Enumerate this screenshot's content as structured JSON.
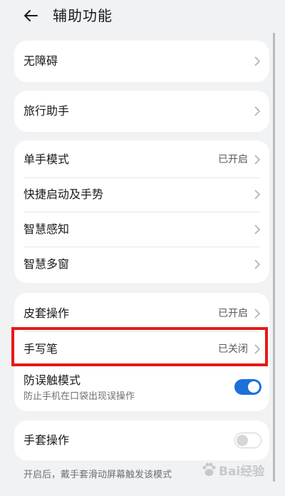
{
  "header": {
    "title": "辅助功能"
  },
  "card1": {
    "item": {
      "label": "无障碍"
    }
  },
  "card2": {
    "item": {
      "label": "旅行助手"
    }
  },
  "card3": {
    "items": [
      {
        "label": "单手模式",
        "status": "已开启"
      },
      {
        "label": "快捷启动及手势",
        "status": ""
      },
      {
        "label": "智慧感知",
        "status": ""
      },
      {
        "label": "智慧多窗",
        "status": ""
      }
    ]
  },
  "card4": {
    "items": [
      {
        "label": "皮套操作",
        "status": "已开启"
      },
      {
        "label": "手写笔",
        "status": "已关闭"
      }
    ],
    "toggle_item": {
      "label": "防误触模式",
      "description": "防止手机在口袋出现误操作",
      "on": true
    }
  },
  "card5": {
    "toggle_item": {
      "label": "手套操作",
      "on": false
    }
  },
  "footnote": "开启后，戴手套滑动屏幕触发该模式",
  "watermark": {
    "text": "Bai经验"
  },
  "colors": {
    "accent": "#1e6fd9",
    "highlight": "#e81818",
    "background": "#f1f2f4"
  }
}
